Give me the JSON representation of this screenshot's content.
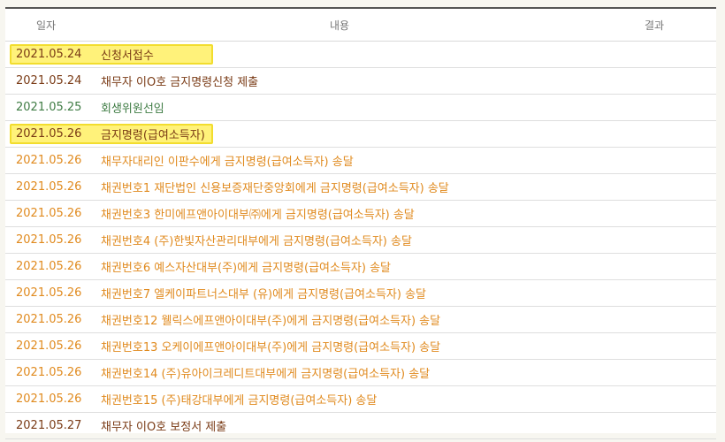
{
  "table": {
    "headers": {
      "date": "일자",
      "content": "내용",
      "result": "결과"
    },
    "rows": [
      {
        "date": "2021.05.24",
        "text": "신청서접수",
        "color": "brown",
        "highlight": true
      },
      {
        "date": "2021.05.24",
        "text": "채무자 이O호 금지명령신청 제출",
        "color": "brown",
        "highlight": false
      },
      {
        "date": "2021.05.25",
        "text": "회생위원선임",
        "color": "green",
        "highlight": false
      },
      {
        "date": "2021.05.26",
        "text": "금지명령(급여소득자)",
        "color": "brown",
        "highlight": true
      },
      {
        "date": "2021.05.26",
        "text": "채무자대리인 이판수에게 금지명령(급여소득자) 송달",
        "color": "orange",
        "highlight": false
      },
      {
        "date": "2021.05.26",
        "text": "채권번호1 재단법인 신용보증재단중앙회에게 금지명령(급여소득자) 송달",
        "color": "orange",
        "highlight": false
      },
      {
        "date": "2021.05.26",
        "text": "채권번호3 한미에프앤아이대부㈜에게 금지명령(급여소득자) 송달",
        "color": "orange",
        "highlight": false
      },
      {
        "date": "2021.05.26",
        "text": "채권번호4 (주)한빛자산관리대부에게 금지명령(급여소득자) 송달",
        "color": "orange",
        "highlight": false
      },
      {
        "date": "2021.05.26",
        "text": "채권번호6 예스자산대부(주)에게 금지명령(급여소득자) 송달",
        "color": "orange",
        "highlight": false
      },
      {
        "date": "2021.05.26",
        "text": "채권번호7 엘케이파트너스대부 (유)에게 금지명령(급여소득자) 송달",
        "color": "orange",
        "highlight": false
      },
      {
        "date": "2021.05.26",
        "text": "채권번호12 웰릭스에프앤아이대부(주)에게 금지명령(급여소득자) 송달",
        "color": "orange",
        "highlight": false
      },
      {
        "date": "2021.05.26",
        "text": "채권번호13 오케이에프앤아이대부(주)에게 금지명령(급여소득자) 송달",
        "color": "orange",
        "highlight": false
      },
      {
        "date": "2021.05.26",
        "text": "채권번호14 (주)유아이크레디트대부에게 금지명령(급여소득자) 송달",
        "color": "orange",
        "highlight": false
      },
      {
        "date": "2021.05.26",
        "text": "채권번호15 (주)태강대부에게 금지명령(급여소득자) 송달",
        "color": "orange",
        "highlight": false
      },
      {
        "date": "2021.05.27",
        "text": "채무자 이O호 보정서 제출",
        "color": "brown",
        "highlight": false
      }
    ]
  },
  "colors": {
    "brown": "#7a3b16",
    "green": "#3f7c44",
    "orange": "#e08a1e",
    "highlight": "#fff27a"
  }
}
